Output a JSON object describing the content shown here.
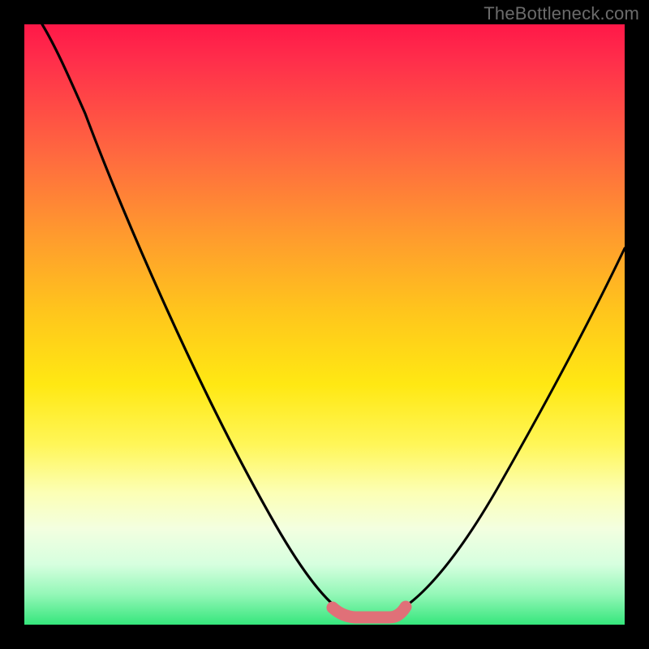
{
  "watermark": {
    "text": "TheBottleneck.com"
  },
  "chart_data": {
    "type": "line",
    "title": "",
    "xlabel": "",
    "ylabel": "",
    "xlim": [
      0,
      100
    ],
    "ylim": [
      0,
      100
    ],
    "grid": false,
    "legend": false,
    "series": [
      {
        "name": "left-curve",
        "x": [
          3,
          6,
          10,
          15,
          20,
          25,
          30,
          35,
          40,
          45,
          50,
          53
        ],
        "y": [
          100,
          94,
          85,
          75,
          65,
          55,
          45,
          35,
          25,
          15,
          5,
          2
        ]
      },
      {
        "name": "right-curve",
        "x": [
          62,
          66,
          70,
          75,
          80,
          85,
          90,
          95,
          100
        ],
        "y": [
          2,
          6,
          12,
          20,
          29,
          38,
          47,
          55,
          63
        ]
      },
      {
        "name": "bottom-segment",
        "x": [
          51,
          54,
          57,
          60,
          63
        ],
        "y": [
          2.5,
          1.8,
          1.8,
          1.8,
          2.8
        ],
        "style": "thick-pink"
      }
    ],
    "colors": {
      "curve": "#000000",
      "bottom_segment": "#e26f6f",
      "gradient_top": "#ff1848",
      "gradient_mid": "#ffe813",
      "gradient_bottom": "#35e67c",
      "background": "#000000",
      "watermark": "#6b6b6b"
    }
  }
}
